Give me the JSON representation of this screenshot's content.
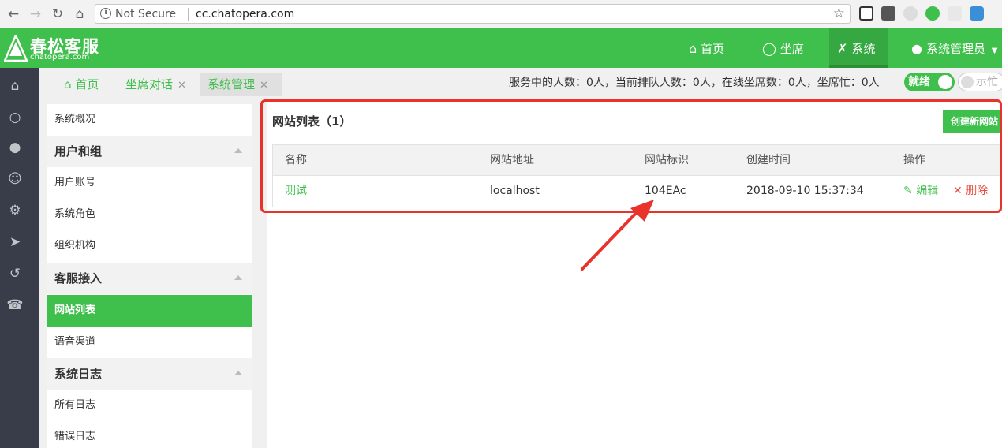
{
  "browser": {
    "security": "Not Secure",
    "url": "cc.chatopera.com"
  },
  "app": {
    "logo_name": "春松客服",
    "logo_sub": "chatopera.com",
    "brand_color": "#3fbf4b",
    "sidebar_color": "#393d49"
  },
  "top_nav": {
    "home": "首页",
    "agent": "坐席",
    "system": "系统",
    "user": "系统管理员"
  },
  "tabs": [
    {
      "label": "首页"
    },
    {
      "label": "坐席对话"
    },
    {
      "label": "系统管理"
    }
  ],
  "stats": {
    "text": "服务中的人数：0人，当前排队人数：0人，在线坐席数：0人，坐席忙：0人"
  },
  "status_toggle": {
    "on_label": "就绪",
    "off_label": "示忙"
  },
  "menu": {
    "overview": "系统概况",
    "group1": "用户和组",
    "user_account": "用户账号",
    "system_role": "系统角色",
    "org": "组织机构",
    "group2": "客服接入",
    "website_list": "网站列表",
    "voice_channel": "语音渠道",
    "group3": "系统日志",
    "all_logs": "所有日志",
    "error_logs": "错误日志"
  },
  "panel": {
    "title": "网站列表（1）",
    "create_button": "创建新网站",
    "columns": {
      "name": "名称",
      "address": "网站地址",
      "id": "网站标识",
      "created": "创建时间",
      "ops": "操作"
    },
    "rows": [
      {
        "name": "测试",
        "address": "localhost",
        "id": "104EAc",
        "created": "2018-09-10 15:37:34",
        "edit": "编辑",
        "delete": "删除"
      }
    ]
  },
  "annotation": {
    "color": "#e8322b"
  }
}
